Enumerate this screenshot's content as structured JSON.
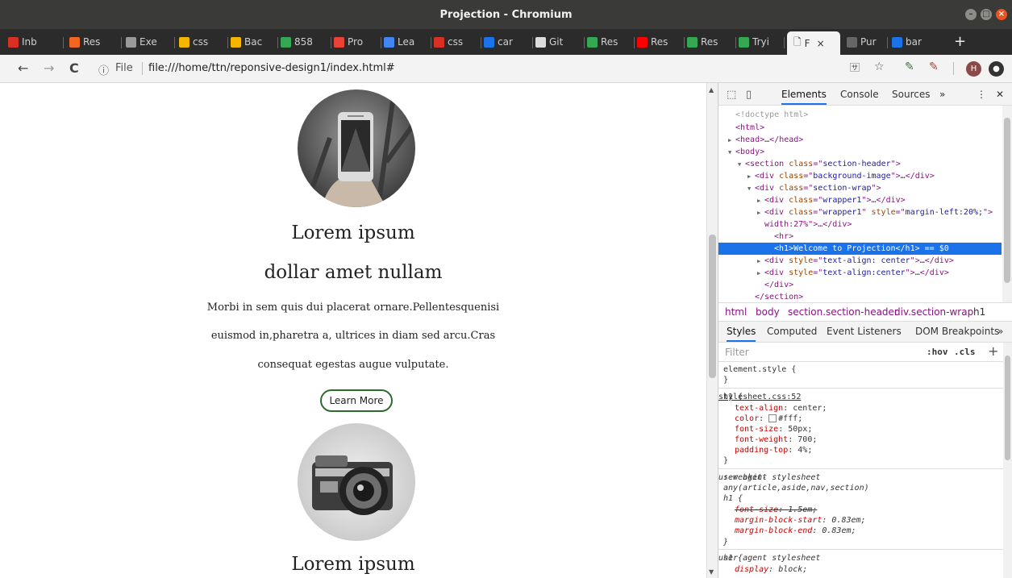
{
  "window": {
    "title": "Projection - Chromium"
  },
  "tabs": [
    {
      "label": "Inb",
      "icon": "gmail-icon",
      "color": "#d93025"
    },
    {
      "label": "Res",
      "icon": "p-logo-icon",
      "color": "#f26522"
    },
    {
      "label": "Exe",
      "icon": "lines-icon",
      "color": "#999999"
    },
    {
      "label": "css",
      "icon": "slides-icon",
      "color": "#f4b400"
    },
    {
      "label": "Bac",
      "icon": "slides-icon",
      "color": "#f4b400"
    },
    {
      "label": "858",
      "icon": "pinwheel-icon",
      "color": "#34a853"
    },
    {
      "label": "Pro",
      "icon": "flower-icon",
      "color": "#ea4335"
    },
    {
      "label": "Lea",
      "icon": "flower-icon",
      "color": "#4285f4"
    },
    {
      "label": "css",
      "icon": "image-icon",
      "color": "#d93025"
    },
    {
      "label": "car",
      "icon": "flag-icon",
      "color": "#1a73e8"
    },
    {
      "label": "Git",
      "icon": "github-icon",
      "color": "#dddddd"
    },
    {
      "label": "Res",
      "icon": "chart-icon",
      "color": "#34a853"
    },
    {
      "label": "Res",
      "icon": "youtube-icon",
      "color": "#ff0000"
    },
    {
      "label": "Res",
      "icon": "chart-icon",
      "color": "#34a853"
    },
    {
      "label": "Tryi",
      "icon": "chart-icon",
      "color": "#34a853"
    },
    {
      "label": "Pur",
      "icon": "globe-icon",
      "color": "#666666"
    },
    {
      "label": "bar",
      "icon": "flag-icon",
      "color": "#1a73e8"
    }
  ],
  "active_tab": {
    "label": "F",
    "close": "×"
  },
  "new_tab": "+",
  "toolbar": {
    "back": "←",
    "forward": "→",
    "reload": "C",
    "info": "ⓘ",
    "scheme": "File",
    "url": "file:///home/ttn/reponsive-design1/index.html#",
    "avatar_letter": "H"
  },
  "page": {
    "heading1": "Lorem ipsum",
    "heading2": "dollar amet nullam",
    "para1": "Morbi in sem quis dui placerat ornare.Pellentesquenisi",
    "para2": "euismod in,pharetra a, ultrices in diam sed arcu.Cras",
    "para3": "consequat egestas augue vulputate.",
    "button": "Learn More",
    "heading3": "Lorem ipsum"
  },
  "devtools": {
    "tabs": [
      "Elements",
      "Console",
      "Sources",
      "»"
    ],
    "more": "⋮",
    "close": "✕",
    "dom": [
      {
        "indent": 0,
        "arrow": "",
        "html": "<!doctype html>",
        "kind": "doctype"
      },
      {
        "indent": 0,
        "arrow": "",
        "open": "html",
        "kind": "tag"
      },
      {
        "indent": 0,
        "arrow": "▶",
        "open": "head",
        "close": "head",
        "kind": "collapsed"
      },
      {
        "indent": 0,
        "arrow": "▼",
        "open": "body",
        "kind": "tag"
      },
      {
        "indent": 1,
        "arrow": "▼",
        "open": "section",
        "attrs": [
          [
            "class",
            "section-header"
          ]
        ],
        "kind": "tag"
      },
      {
        "indent": 2,
        "arrow": "▶",
        "open": "div",
        "attrs": [
          [
            "class",
            "background-image"
          ]
        ],
        "close": "div",
        "kind": "collapsed"
      },
      {
        "indent": 2,
        "arrow": "▼",
        "open": "div",
        "attrs": [
          [
            "class",
            "section-wrap"
          ]
        ],
        "kind": "tag"
      },
      {
        "indent": 3,
        "arrow": "▶",
        "open": "div",
        "attrs": [
          [
            "class",
            "wrapper1"
          ]
        ],
        "close": "div",
        "kind": "collapsed"
      },
      {
        "indent": 3,
        "arrow": "▶",
        "open": "div",
        "attrs": [
          [
            "class",
            "wrapper1"
          ],
          [
            "style",
            "margin-left:20%;"
          ]
        ],
        "kind": "tag"
      },
      {
        "indent": 3,
        "arrow": "",
        "text": "width:27%\">…</div>",
        "kind": "cont"
      },
      {
        "indent": 4,
        "arrow": "",
        "open": "hr",
        "kind": "tag"
      },
      {
        "indent": 4,
        "arrow": "",
        "text": "<h1>Welcome to Projection</h1> == $0",
        "kind": "selected"
      },
      {
        "indent": 3,
        "arrow": "▶",
        "open": "div",
        "attrs": [
          [
            "style",
            "text-align: center"
          ]
        ],
        "close": "div",
        "kind": "collapsed"
      },
      {
        "indent": 3,
        "arrow": "▶",
        "open": "div",
        "attrs": [
          [
            "style",
            "text-align:center"
          ]
        ],
        "close": "div",
        "kind": "collapsed"
      },
      {
        "indent": 3,
        "arrow": "",
        "text": "</div>",
        "kind": "closing"
      },
      {
        "indent": 2,
        "arrow": "",
        "text": "</section>",
        "kind": "closing"
      }
    ],
    "breadcrumbs": [
      "html",
      "body",
      "section.section-header",
      "div.section-wrap",
      "h1"
    ],
    "style_tabs": [
      "Styles",
      "Computed",
      "Event Listeners",
      "DOM Breakpoints",
      "»"
    ],
    "filter_placeholder": "Filter",
    "hov": ":hov",
    "cls": ".cls",
    "plus": "+",
    "styles": {
      "element_selector": "element.style {",
      "element_close": "}",
      "rule1": {
        "selector": "h1 {",
        "source": "stylesheet.css:52",
        "decls": [
          [
            "text-align",
            "center;"
          ],
          [
            "color",
            "#fff;"
          ],
          [
            "font-size",
            "50px;"
          ],
          [
            "font-weight",
            "700;"
          ],
          [
            "padding-top",
            "4%;"
          ]
        ],
        "close": "}"
      },
      "rule2": {
        "selector_a": ":-webkit-",
        "selector_b": "any(article,aside,nav,section)",
        "selector_c": "h1 {",
        "source": "user agent stylesheet",
        "decls": [
          [
            "font-size",
            "1.5em;"
          ],
          [
            "margin-block-start",
            "0.83em;"
          ],
          [
            "margin-block-end",
            "0.83em;"
          ]
        ],
        "close": "}"
      },
      "rule3": {
        "selector": "h1 {",
        "source": "user agent stylesheet",
        "decls": [
          [
            "display",
            "block;"
          ]
        ]
      }
    }
  }
}
